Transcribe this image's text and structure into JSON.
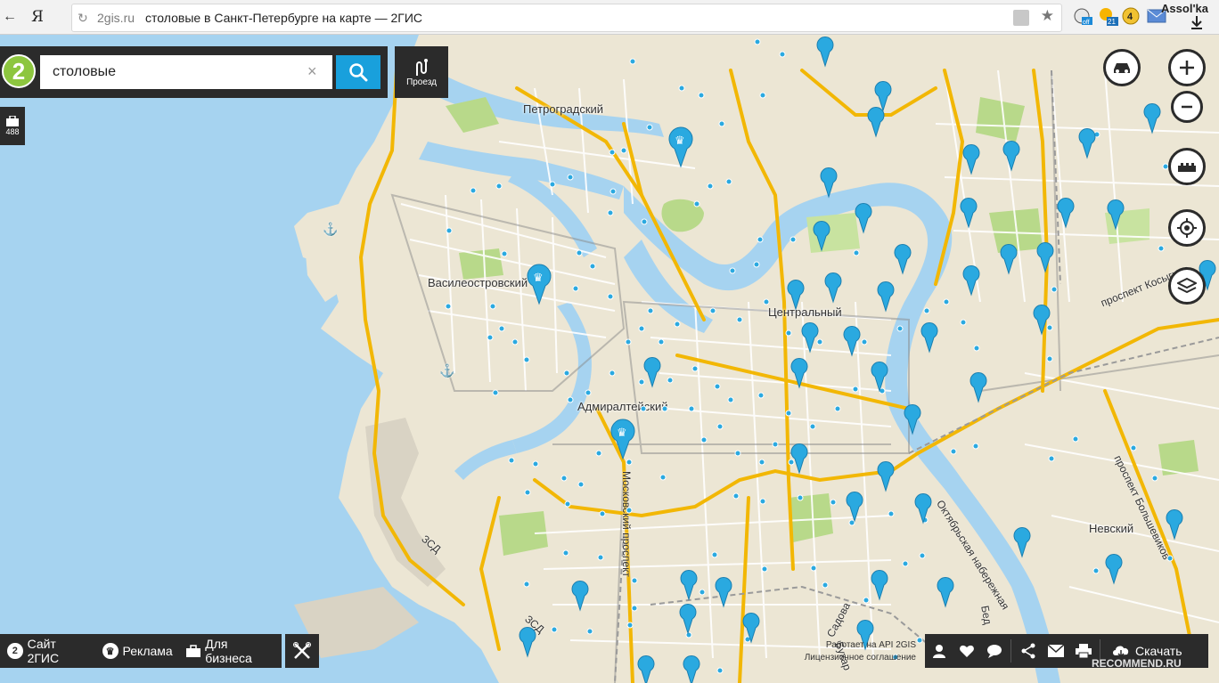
{
  "browser": {
    "back_icon": "back-arrow-icon",
    "yandex_logo": "Я",
    "url_domain": "2gis.ru",
    "page_title": "столовые в Санкт-Петербурге на карте — 2ГИС",
    "ext_weather_badge": "21",
    "ext_notify_count": "4",
    "ext_off_label": "off",
    "user_name": "Assol'ka"
  },
  "search": {
    "logo_text": "2",
    "query": "столовые",
    "clear_label": "×",
    "route_label": "Проезд"
  },
  "sidebar": {
    "business_count": "488"
  },
  "map": {
    "districts": {
      "petrogradsky": "Петроградский",
      "vasileostrovsky": "Василеостровский",
      "centralny": "Центральный",
      "admiralteysky": "Адмиралтейский",
      "nevsky": "Невский"
    },
    "streets": {
      "moskovsky": "Московский проспект",
      "kosygina": "проспект Косыгина",
      "oktyabrskaya": "Октябрьская набережная",
      "bolshevikov": "проспект Большевиков",
      "zsd_1": "ЗСД",
      "zsd_2": "ЗСД",
      "sadovaya": "Садова",
      "bukhar": "Бухар",
      "bed": "Бед"
    }
  },
  "footer": {
    "site_label": "Сайт 2ГИС",
    "ads_label": "Реклама",
    "business_label": "Для бизнеса",
    "api_line1": "Работает на API 2GIS",
    "api_line2": "Лицензионное соглашение",
    "download_label": "Скачать",
    "watermark": "RECOMMEND.RU"
  },
  "colors": {
    "water": "#a6d3f0",
    "land": "#ece6d4",
    "park": "#b8d98a",
    "road_major": "#f2b705",
    "panel": "#2b2b2b",
    "accent": "#19a0dc",
    "pin": "#2aa9e0"
  }
}
